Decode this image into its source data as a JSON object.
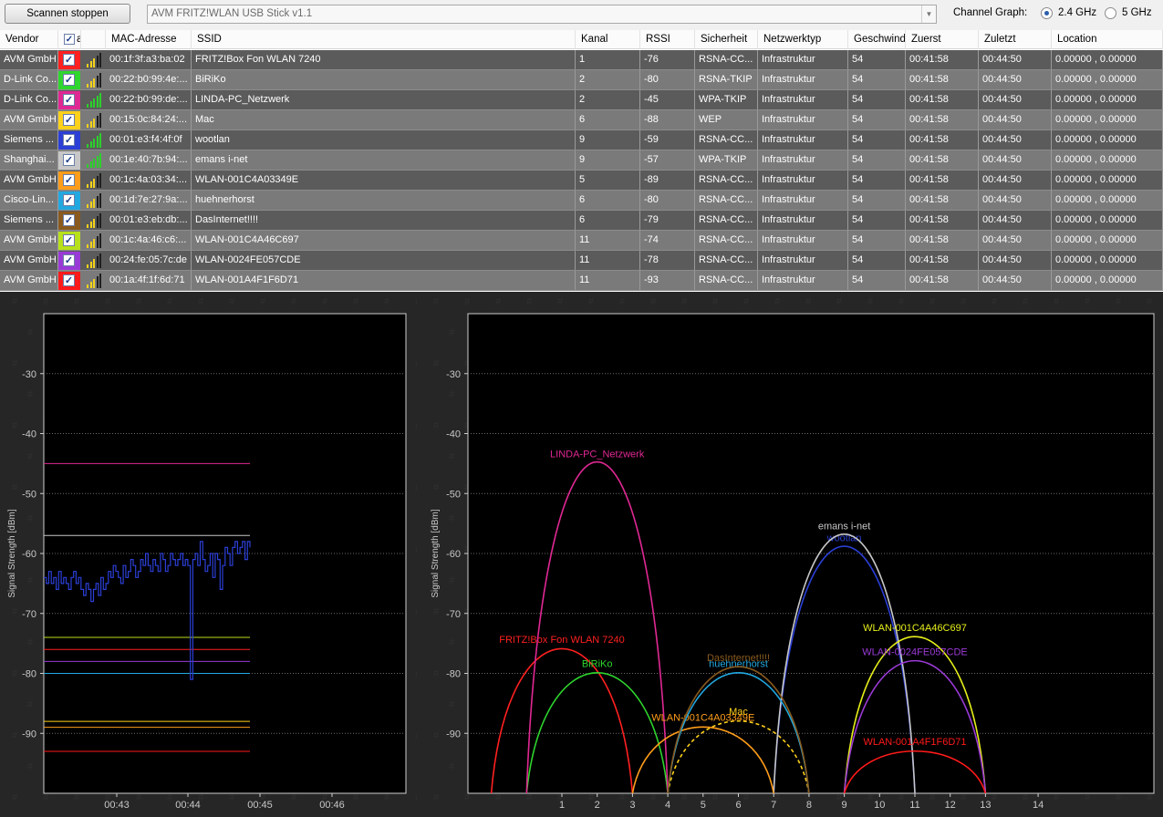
{
  "toolbar": {
    "stop_button": "Scannen stoppen",
    "adapter": "AVM FRITZ!WLAN USB Stick v1.1",
    "channel_graph_label": "Channel Graph:",
    "band_24": "2.4 GHz",
    "band_5": "5 GHz",
    "selected_band": "2.4 GHz"
  },
  "table": {
    "columns": [
      "Vendor",
      "a",
      "",
      "MAC-Adresse",
      "SSID",
      "Kanal",
      "RSSI",
      "Sicherheit",
      "Netzwerktyp",
      "Geschwindi",
      "Zuerst",
      "Zuletzt",
      "Location"
    ],
    "rows": [
      {
        "vendor": "AVM GmbH",
        "color": "#ff2020",
        "checked": "✓",
        "mac": "00:1f:3f:a3:ba:02",
        "ssid": "FRITZ!Box Fon WLAN 7240",
        "kanal": "1",
        "rssi": "-76",
        "sicherheit": "RSNA-CC...",
        "typ": "Infrastruktur",
        "speed": "54",
        "zuerst": "00:41:58",
        "zuletzt": "00:44:50",
        "location": "0.00000 , 0.00000",
        "bars": 3
      },
      {
        "vendor": "D-Link Co...",
        "color": "#2ed62e",
        "checked": "✓",
        "mac": "00:22:b0:99:4e:...",
        "ssid": "BiRiKo",
        "kanal": "2",
        "rssi": "-80",
        "sicherheit": "RSNA-TKIP",
        "typ": "Infrastruktur",
        "speed": "54",
        "zuerst": "00:41:58",
        "zuletzt": "00:44:50",
        "location": "0.00000 , 0.00000",
        "bars": 3
      },
      {
        "vendor": "D-Link Co...",
        "color": "#e02893",
        "checked": "✓",
        "mac": "00:22:b0:99:de:...",
        "ssid": "LINDA-PC_Netzwerk",
        "kanal": "2",
        "rssi": "-45",
        "sicherheit": "WPA-TKIP",
        "typ": "Infrastruktur",
        "speed": "54",
        "zuerst": "00:41:58",
        "zuletzt": "00:44:50",
        "location": "0.00000 , 0.00000",
        "bars": 5
      },
      {
        "vendor": "AVM GmbH",
        "color": "#ffd11a",
        "checked": "✓",
        "mac": "00:15:0c:84:24:...",
        "ssid": "Mac",
        "kanal": "6",
        "rssi": "-88",
        "sicherheit": "WEP",
        "typ": "Infrastruktur",
        "speed": "54",
        "zuerst": "00:41:58",
        "zuletzt": "00:44:50",
        "location": "0.00000 , 0.00000",
        "bars": 3
      },
      {
        "vendor": "Siemens ...",
        "color": "#2b3fd6",
        "checked": "✓",
        "mac": "00:01:e3:f4:4f:0f",
        "ssid": "wootlan",
        "kanal": "9",
        "rssi": "-59",
        "sicherheit": "RSNA-CC...",
        "typ": "Infrastruktur",
        "speed": "54",
        "zuerst": "00:41:58",
        "zuletzt": "00:44:50",
        "location": "0.00000 , 0.00000",
        "bars": 5
      },
      {
        "vendor": "Shanghai...",
        "color": "#c7c7c7",
        "checked": "✓",
        "mac": "00:1e:40:7b:94:...",
        "ssid": "emans i-net",
        "kanal": "9",
        "rssi": "-57",
        "sicherheit": "WPA-TKIP",
        "typ": "Infrastruktur",
        "speed": "54",
        "zuerst": "00:41:58",
        "zuletzt": "00:44:50",
        "location": "0.00000 , 0.00000",
        "bars": 5
      },
      {
        "vendor": "AVM GmbH",
        "color": "#ff9d1a",
        "checked": "✓",
        "mac": "00:1c:4a:03:34:...",
        "ssid": "WLAN-001C4A03349E",
        "kanal": "5",
        "rssi": "-89",
        "sicherheit": "RSNA-CC...",
        "typ": "Infrastruktur",
        "speed": "54",
        "zuerst": "00:41:58",
        "zuletzt": "00:44:50",
        "location": "0.00000 , 0.00000",
        "bars": 3
      },
      {
        "vendor": "Cisco-Lin...",
        "color": "#22a8e0",
        "checked": "✓",
        "mac": "00:1d:7e:27:9a:...",
        "ssid": "huehnerhorst",
        "kanal": "6",
        "rssi": "-80",
        "sicherheit": "RSNA-CC...",
        "typ": "Infrastruktur",
        "speed": "54",
        "zuerst": "00:41:58",
        "zuletzt": "00:44:50",
        "location": "0.00000 , 0.00000",
        "bars": 3
      },
      {
        "vendor": "Siemens ...",
        "color": "#8a5a1e",
        "checked": "✓",
        "mac": "00:01:e3:eb:db:...",
        "ssid": "DasInternet!!!!",
        "kanal": "6",
        "rssi": "-79",
        "sicherheit": "RSNA-CC...",
        "typ": "Infrastruktur",
        "speed": "54",
        "zuerst": "00:41:58",
        "zuletzt": "00:44:50",
        "location": "0.00000 , 0.00000",
        "bars": 3
      },
      {
        "vendor": "AVM GmbH",
        "color": "#b8e01a",
        "checked": "✓",
        "mac": "00:1c:4a:46:c6:...",
        "ssid": "WLAN-001C4A46C697",
        "kanal": "11",
        "rssi": "-74",
        "sicherheit": "RSNA-CC...",
        "typ": "Infrastruktur",
        "speed": "54",
        "zuerst": "00:41:58",
        "zuletzt": "00:44:50",
        "location": "0.00000 , 0.00000",
        "bars": 3
      },
      {
        "vendor": "AVM GmbH",
        "color": "#9a3ad6",
        "checked": "✓",
        "mac": "00:24:fe:05:7c:de",
        "ssid": "WLAN-0024FE057CDE",
        "kanal": "11",
        "rssi": "-78",
        "sicherheit": "RSNA-CC...",
        "typ": "Infrastruktur",
        "speed": "54",
        "zuerst": "00:41:58",
        "zuletzt": "00:44:50",
        "location": "0.00000 , 0.00000",
        "bars": 3
      },
      {
        "vendor": "AVM GmbH",
        "color": "#ff1a1a",
        "checked": "✓",
        "mac": "00:1a:4f:1f:6d:71",
        "ssid": "WLAN-001A4F1F6D71",
        "kanal": "11",
        "rssi": "-93",
        "sicherheit": "RSNA-CC...",
        "typ": "Infrastruktur",
        "speed": "54",
        "zuerst": "00:41:58",
        "zuletzt": "00:44:50",
        "location": "0.00000 , 0.00000",
        "bars": 3
      }
    ]
  },
  "chart_data": [
    {
      "type": "line",
      "ylabel": "Signal Strength [dBm]",
      "ylim": [
        -100,
        -20
      ],
      "yticks": [
        -30,
        -40,
        -50,
        -60,
        -70,
        -80,
        -90
      ],
      "xticks": [
        "00:43",
        "00:44",
        "00:45",
        "00:46"
      ],
      "grid": true,
      "levels": [
        {
          "ssid": "LINDA-PC_Netzwerk",
          "color": "#e02893",
          "rssi": -45
        },
        {
          "ssid": "emans i-net",
          "color": "#c7c7c7",
          "rssi": -57
        },
        {
          "ssid": "WLAN-001C4A46C697",
          "color": "#b8e01a",
          "rssi": -74
        },
        {
          "ssid": "FRITZ!Box Fon WLAN 7240",
          "color": "#ff2020",
          "rssi": -76
        },
        {
          "ssid": "WLAN-0024FE057CDE",
          "color": "#9a3ad6",
          "rssi": -78
        },
        {
          "ssid": "huehnerhorst",
          "color": "#22a8e0",
          "rssi": -80
        },
        {
          "ssid": "Mac",
          "color": "#ffd11a",
          "rssi": -88
        },
        {
          "ssid": "WLAN-001C4A03349E",
          "color": "#ff9d1a",
          "rssi": -89
        },
        {
          "ssid": "WLAN-001A4F1F6D71",
          "color": "#ff1a1a",
          "rssi": -93
        }
      ],
      "selected_series": {
        "ssid": "wootlan",
        "color": "#2b3fd6",
        "values": [
          -64,
          -65,
          -63,
          -65,
          -64,
          -66,
          -63,
          -65,
          -64,
          -65,
          -66,
          -64,
          -63,
          -65,
          -64,
          -66,
          -67,
          -65,
          -66,
          -68,
          -66,
          -65,
          -67,
          -64,
          -66,
          -65,
          -63,
          -64,
          -62,
          -63,
          -64,
          -65,
          -62,
          -64,
          -63,
          -61,
          -62,
          -64,
          -63,
          -61,
          -62,
          -60,
          -62,
          -63,
          -61,
          -62,
          -63,
          -60,
          -61,
          -63,
          -62,
          -60,
          -61,
          -62,
          -61,
          -60,
          -62,
          -61,
          -62,
          -81,
          -61,
          -60,
          -62,
          -58,
          -61,
          -63,
          -62,
          -60,
          -64,
          -60,
          -61,
          -66,
          -62,
          -59,
          -60,
          -62,
          -59,
          -58,
          -60,
          -59,
          -58,
          -61,
          -58,
          -59
        ]
      }
    },
    {
      "type": "area",
      "ylabel": "Signal Strength [dBm]",
      "ylim": [
        -100,
        -20
      ],
      "yticks": [
        -30,
        -40,
        -50,
        -60,
        -70,
        -80,
        -90
      ],
      "xticks": [
        "1",
        "2",
        "3",
        "4",
        "5",
        "6",
        "7",
        "8",
        "9",
        "10",
        "11",
        "12",
        "13",
        "14"
      ],
      "series": [
        {
          "name": "FRITZ!Box Fon WLAN 7240",
          "channel": 1,
          "rssi": -76,
          "color": "#ff2020"
        },
        {
          "name": "BiRiKo",
          "channel": 2,
          "rssi": -80,
          "color": "#2ed62e"
        },
        {
          "name": "LINDA-PC_Netzwerk",
          "channel": 2,
          "rssi": -45,
          "color": "#e02893"
        },
        {
          "name": "Mac",
          "channel": 6,
          "rssi": -88,
          "color": "#ffd11a",
          "dashed": true
        },
        {
          "name": "wootlan",
          "channel": 9,
          "rssi": -59,
          "color": "#2b3fd6"
        },
        {
          "name": "emans i-net",
          "channel": 9,
          "rssi": -57,
          "color": "#c7c7c7"
        },
        {
          "name": "WLAN-001C4A03349E",
          "channel": 5,
          "rssi": -89,
          "color": "#ff9d1a"
        },
        {
          "name": "huehnerhorst",
          "channel": 6,
          "rssi": -80,
          "color": "#22a8e0"
        },
        {
          "name": "DasInternet!!!!",
          "channel": 6,
          "rssi": -79,
          "color": "#8a5a1e"
        },
        {
          "name": "WLAN-001C4A46C697",
          "channel": 11,
          "rssi": -74,
          "color": "#e6ef1a"
        },
        {
          "name": "WLAN-0024FE057CDE",
          "channel": 11,
          "rssi": -78,
          "color": "#9a3ad6"
        },
        {
          "name": "WLAN-001A4F1F6D71",
          "channel": 11,
          "rssi": -93,
          "color": "#ff1a1a"
        }
      ]
    }
  ]
}
